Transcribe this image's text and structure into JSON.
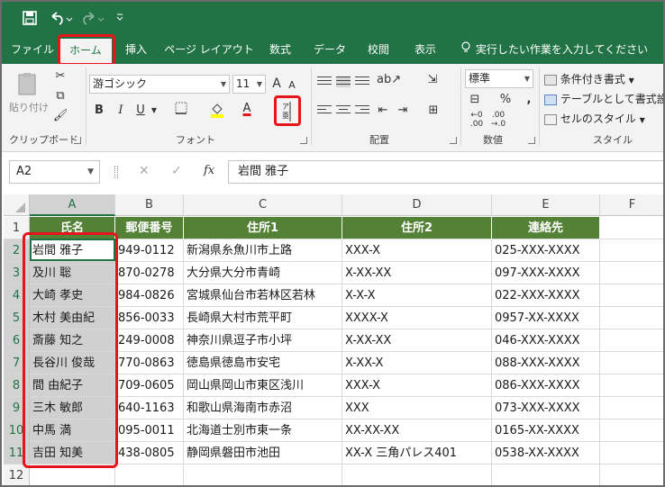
{
  "quick_access": {
    "save_icon": "save-icon",
    "undo_icon": "undo-icon",
    "redo_icon": "redo-icon",
    "customize_icon": "customize-icon"
  },
  "tabs": [
    "ファイル",
    "ホーム",
    "挿入",
    "ページ レイアウト",
    "数式",
    "データ",
    "校閲",
    "表示"
  ],
  "tell_me": "実行したい作業を入力してください",
  "ribbon": {
    "clipboard": {
      "paste_label": "貼り付け",
      "group_label": "クリップボード"
    },
    "font": {
      "font_name": "游ゴシック",
      "font_size": "11",
      "bold": "B",
      "italic": "I",
      "underline": "U",
      "font_color_letter": "A",
      "grow": "A",
      "shrink": "A",
      "group_label": "フォント"
    },
    "alignment": {
      "group_label": "配置"
    },
    "number": {
      "format": "標準",
      "percent": "%",
      "comma": ",",
      "group_label": "数値"
    },
    "styles": {
      "conditional": "条件付き書式",
      "table": "テーブルとして書式設定",
      "cell_style": "セルのスタイル",
      "group_label": "スタイル"
    }
  },
  "formula_bar": {
    "name_box": "A2",
    "fx": "fx",
    "cancel": "✕",
    "enter": "✓",
    "content": "岩間 雅子"
  },
  "columns": [
    "A",
    "B",
    "C",
    "D",
    "E",
    "F"
  ],
  "row_numbers": [
    "1",
    "2",
    "3",
    "4",
    "5",
    "6",
    "7",
    "8",
    "9",
    "10",
    "11",
    "12"
  ],
  "header": [
    "氏名",
    "郵便番号",
    "住所1",
    "住所2",
    "連絡先"
  ],
  "rows": [
    [
      "岩間 雅子",
      "949-0112",
      "新潟県糸魚川市上路",
      "XXX-X",
      "025-XXX-XXXX"
    ],
    [
      "及川 聡",
      "870-0278",
      "大分県大分市青崎",
      "X-XX-XX",
      "097-XXX-XXXX"
    ],
    [
      "大崎 孝史",
      "984-0826",
      "宮城県仙台市若林区若林",
      "X-X-X",
      "022-XXX-XXXX"
    ],
    [
      "木村 美由紀",
      "856-0033",
      "長崎県大村市荒平町",
      "XXXX-X",
      "0957-XX-XXXX"
    ],
    [
      "斎藤 知之",
      "249-0008",
      "神奈川県逗子市小坪",
      "X-XX-XX",
      "046-XXX-XXXX"
    ],
    [
      "長谷川 俊哉",
      "770-0863",
      "徳島県徳島市安宅",
      "X-XX-X",
      "088-XXX-XXXX"
    ],
    [
      "間 由紀子",
      "709-0605",
      "岡山県岡山市東区浅川",
      "XXX-X",
      "086-XXX-XXXX"
    ],
    [
      "三木 敏郎",
      "640-1163",
      "和歌山県海南市赤沼",
      "XXX",
      "073-XXX-XXXX"
    ],
    [
      "中馬 満",
      "095-0011",
      "北海道士別市東一条",
      "XX-XX-XX",
      "0165-XX-XXXX"
    ],
    [
      "吉田 知美",
      "438-0805",
      "静岡県磐田市池田",
      "XX-X 三角パレス401",
      "0538-XX-XXXX"
    ]
  ],
  "colors": {
    "excel_green": "#217346",
    "header_fill": "#538135",
    "highlight": "#e8141c"
  }
}
